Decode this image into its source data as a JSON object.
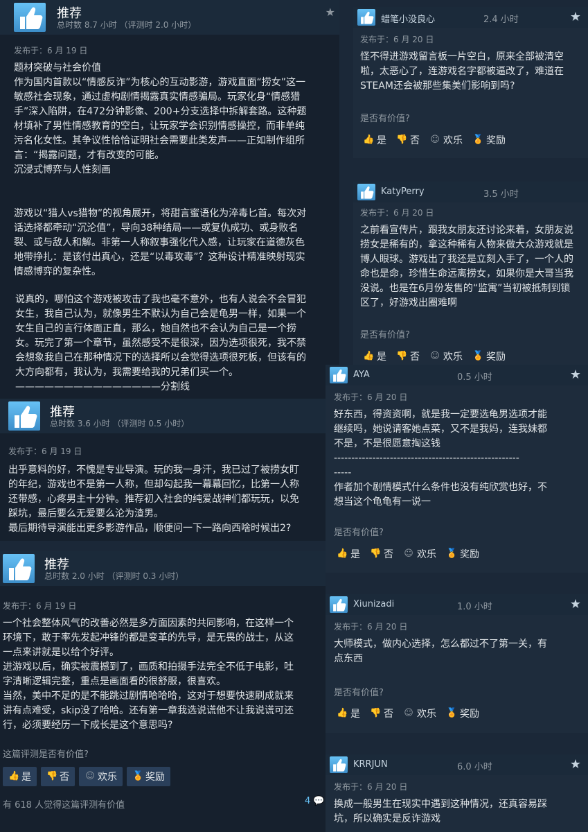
{
  "main_review_1": {
    "title": "推荐",
    "hours": "总时数 8.7 小时 （评测时 2.0 小时）",
    "posted": "发布于：6 月 19 日",
    "body": "题材突破与社会价值\n作为国内首款以“情感反诈”为核心的互动影游，游戏直面“捞女”这一\n敏感社会现象，通过虚构剧情揭露真实情感骗局。玩家化身“情感猎\n手”深入陷阱，在472分钟影像、200+分支选择中拆解套路。这种题\n材填补了男性情感教育的空白，让玩家学会识别情感操控，而非单纯\n污名化女性。其争议性恰恰证明社会需要此类发声——正如制作组所\n言：“揭露问题，才有改变的可能。\n沉浸式博弈与人性刻画\n\n\n游戏以“猎人vs猎物”的视角展开，将甜言蜜语化为淬毒匕首。每次对\n话选择都牵动“沉沦值”，导向38种结局——或复仇成功、或身败名\n裂、或与敌人和解。非第一人称叙事强化代入感，让玩家在道德灰色\n地带挣扎：是该付出真心，还是“以毒攻毒”？这种设计精准映射现实\n情感博弈的复杂性。"
  },
  "fragment_review": {
    "body": "说真的，哪怕这个游戏被攻击了我也毫不意外，也有人说会不会冒犯\n女生，我自己认为，就像男生不默认为自己会是龟男一样，如果一个\n女生自己的言行体面正直，那么，她自然也不会认为自己是一个捞\n女。玩完了第一个章节，虽然感受不是很深，因为选项很死，我不禁\n会想象我自己在那种情况下的选择所以会觉得选项很死板，但该有的\n大方向都有，我认为，我需要给我的兄弟们买一个。\n———————————————分割线"
  },
  "main_review_2": {
    "title": "推荐",
    "hours": "总时数 3.6 小时 （评测时 0.5 小时）",
    "posted": "发布于：6 月 19 日",
    "body": "出乎意料的好，不愧是专业导演。玩的我一身汗，我已过了被捞女盯\n的年纪，游戏也不是第一人称，但却勾起我一幕幕回忆，比第一人称\n还带感，心疼男主十分钟。推荐初入社会的纯爱战神们都玩玩，以免\n踩坑，最后要么无爱要么沦为渣男。\n最后期待导演能出更多影游作品，顺便问一下一路向西啥时候出2?"
  },
  "main_review_3": {
    "title": "推荐",
    "hours": "总时数 2.0 小时 （评测时 0.3 小时）",
    "posted": "发布于：6 月 19 日",
    "body": "一个社会整体风气的改善必然是多方面因素的共同影响，在这样一个\n环境下，敢于率先发起冲锋的都是变革的先导，是无畏的战士，从这\n一点来讲就是以给个好评。\n进游戏以后，确实被震撼到了，画质和拍摄手法完全不低于电影，吐\n字清晰逻辑完整，重点是画面看的很舒服，很喜欢。\n当然，美中不足的是不能跳过剧情哈哈哈，这对于想要快速刷成就来\n讲有点难受，skip没了哈哈。还有第一章我选说谎他不让我说谎可还\n行，必须要经历一下成长是这个意思吗?",
    "helpful_q": "这篇评测是否有价值?",
    "footer": "有 618 人觉得这篇评测有价值",
    "comments": "4"
  },
  "buttons": {
    "yes": "是",
    "no": "否",
    "funny": "欢乐",
    "award": "奖励"
  },
  "helpful_q_short": "是否有价值?",
  "side_reviews": [
    {
      "name": "蜡笔小没良心",
      "hours": "2.4 小时",
      "posted": "发布于：6 月 20 日",
      "body": "怪不得进游戏留言板一片空白，原来全部被清空\n啦，太恶心了，连游戏名字都被逼改了，难道在\nSTEAM还会被那些集美们影响到吗?"
    },
    {
      "name": "KatyPerry",
      "hours": "3.5 小时",
      "posted": "发布于：6 月 20 日",
      "body": "之前看宣传片，跟我女朋友还讨论来着，女朋友说\n捞女是稀有的，拿这种稀有人物来做大众游戏就是\n博人眼球。游戏出了我还是立刻入手了，一个人的\n命也是命，珍惜生命远离捞女，如果你是大哥当我\n没说。也是在6月份发售的“监寓”当初被抵制到锁\n区了，好游戏出圈难啊"
    },
    {
      "name": "AYA",
      "hours": "0.5 小时",
      "posted": "发布于：6 月 20 日",
      "body": "好东西，得资资啊，就是我一定要选龟男选项才能\n继续吗，她说请客她点菜，又不是我妈，连我妹都\n不是，不是很愿意掏这钱\n-----------------------------------------------------\n-----\n作者加个剧情模式什么条件也没有纯欣赏也好，不\n想当这个龟龟有一说一"
    },
    {
      "name": "Xiunizadi",
      "hours": "1.0 小时",
      "posted": "发布于：6 月 20 日",
      "body": "大师模式，做内心选择，怎么都过不了第一关，有\n点东西"
    },
    {
      "name": "KRRJUN",
      "hours": "6.0 小时",
      "posted": "发布于：6 月 20 日",
      "body": "换成一般男生在现实中遇到这种情况，还真容易踩\n坑，所以确实是反诈游戏"
    }
  ]
}
